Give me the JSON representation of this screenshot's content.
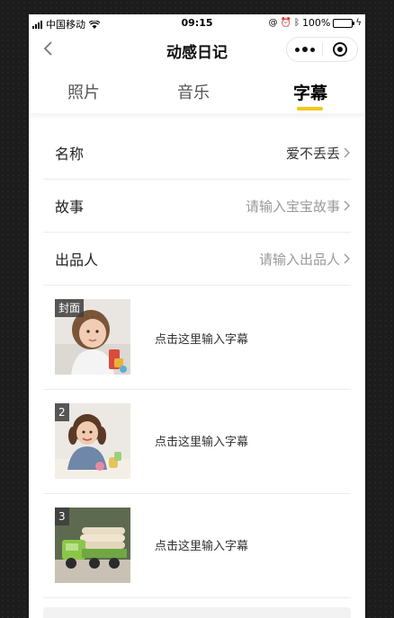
{
  "status_bar": {
    "carrier": "中国移动",
    "time": "09:15",
    "battery": "100%"
  },
  "nav": {
    "title": "动感日记"
  },
  "tabs": [
    {
      "label": "照片",
      "active": false
    },
    {
      "label": "音乐",
      "active": false
    },
    {
      "label": "字幕",
      "active": true
    }
  ],
  "form": {
    "name": {
      "label": "名称",
      "value": "爱不丢丢"
    },
    "story": {
      "label": "故事",
      "placeholder": "请输入宝宝故事"
    },
    "producer": {
      "label": "出品人",
      "placeholder": "请输入出品人"
    }
  },
  "photos": [
    {
      "badge": "封面",
      "caption": "点击这里输入字幕",
      "icon": "photo-girl-with-toy"
    },
    {
      "badge": "2",
      "caption": "点击这里输入字幕",
      "icon": "photo-girl-at-table"
    },
    {
      "badge": "3",
      "caption": "点击这里输入字幕",
      "icon": "photo-toy-truck"
    }
  ],
  "colors": {
    "accent": "#f5c518",
    "background": "#1c1c1c",
    "battery": "#4cd964"
  }
}
